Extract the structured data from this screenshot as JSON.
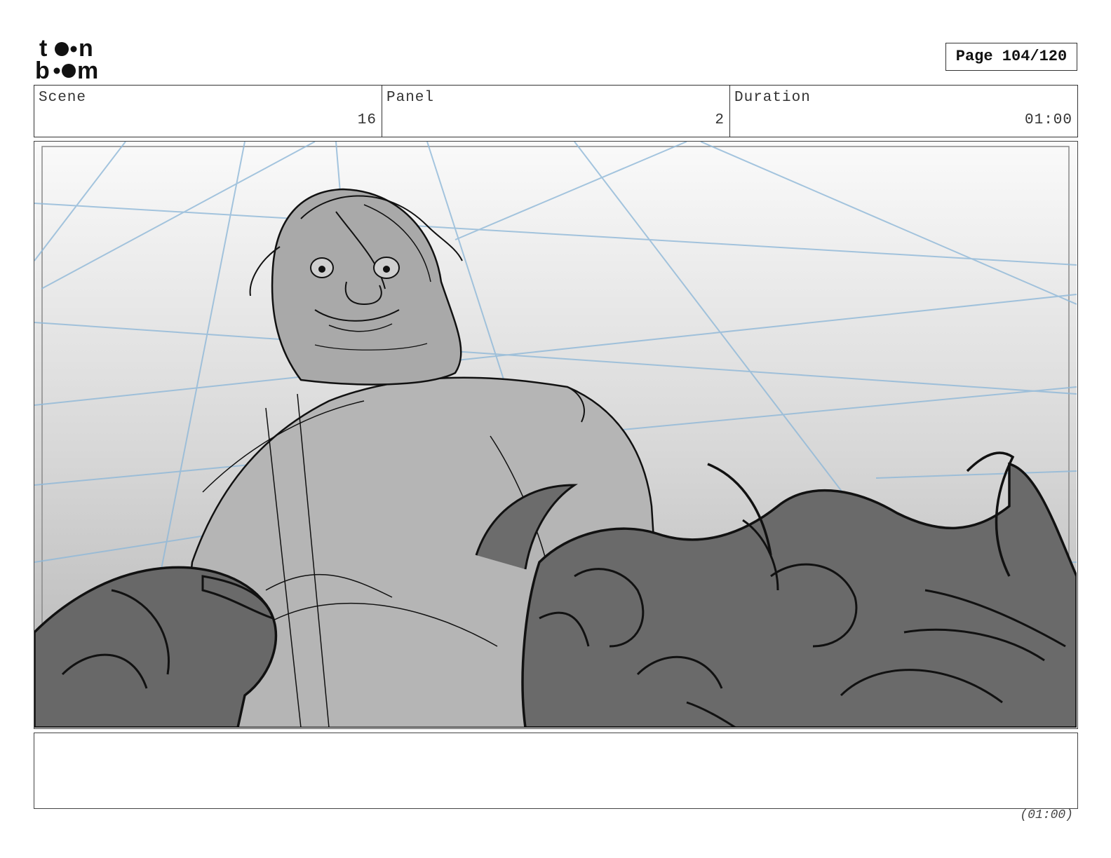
{
  "brand": {
    "logo_top": "to•n",
    "logo_bottom": "b••m"
  },
  "page": {
    "label": "Page 104/120"
  },
  "header": {
    "scene": {
      "label": "Scene",
      "value": "16"
    },
    "panel": {
      "label": "Panel",
      "value": "2"
    },
    "duration": {
      "label": "Duration",
      "value": "01:00"
    }
  },
  "notes": {
    "text": ""
  },
  "footer": {
    "duration": "(01:00)"
  }
}
